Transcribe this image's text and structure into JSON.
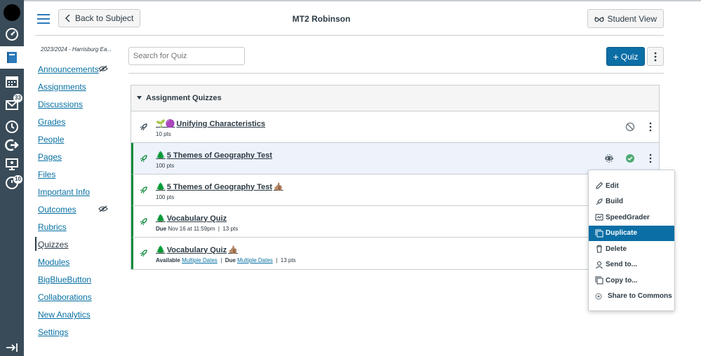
{
  "global_nav": {
    "inbox_badge": "33",
    "history_badge": "10"
  },
  "header": {
    "back_label": "Back to Subject",
    "title": "MT2 Robinson",
    "student_view_label": "Student View"
  },
  "course_nav": {
    "term": "2023/2024 - Harrisburg Ea...",
    "items": [
      {
        "label": "Announcements"
      },
      {
        "label": "Assignments"
      },
      {
        "label": "Discussions"
      },
      {
        "label": "Grades"
      },
      {
        "label": "People"
      },
      {
        "label": "Pages"
      },
      {
        "label": "Files"
      },
      {
        "label": "Important Info"
      },
      {
        "label": "Outcomes"
      },
      {
        "label": "Rubrics"
      },
      {
        "label": "Quizzes"
      },
      {
        "label": "Modules"
      },
      {
        "label": "BigBlueButton"
      },
      {
        "label": "Collaborations"
      },
      {
        "label": "New Analytics"
      },
      {
        "label": "Settings"
      }
    ]
  },
  "toolbar": {
    "search_placeholder": "Search for Quiz",
    "add_quiz_label": "Quiz"
  },
  "quiz_group": {
    "title": "Assignment Quizzes",
    "quizzes": [
      {
        "emoji": "🌱🟣",
        "name": "Unifying Characteristics",
        "suffix": "",
        "pts": "10 pts"
      },
      {
        "emoji": "🌲",
        "name": "5 Themes of Geography Test",
        "suffix": "",
        "pts": "100 pts"
      },
      {
        "emoji": "🌲",
        "name": "5 Themes of Geography Test",
        "suffix": "👍🏽",
        "pts": "100 pts"
      },
      {
        "emoji": "🌲",
        "name": "Vocabulary Quiz",
        "suffix": "",
        "due_label": "Due",
        "due_value": "Nov 16 at 11:59pm",
        "pts": "13 pts"
      },
      {
        "emoji": "🌲",
        "name": "Vocabulary Quiz",
        "suffix": "👍🏽",
        "available_label": "Available",
        "available_value": "Multiple Dates",
        "due_label": "Due",
        "due_value": "Multiple Dates",
        "pts": "13 pts"
      }
    ]
  },
  "menu": {
    "items": [
      {
        "label": "Edit"
      },
      {
        "label": "Build"
      },
      {
        "label": "SpeedGrader"
      },
      {
        "label": "Duplicate"
      },
      {
        "label": "Delete"
      },
      {
        "label": "Send to..."
      },
      {
        "label": "Copy to..."
      },
      {
        "label": "Share to Commons"
      }
    ]
  },
  "colors": {
    "nav_bg": "#394b58",
    "brand_blue": "#0b6ea5",
    "link": "#0770a3",
    "published_green": "#0b8a3c"
  }
}
